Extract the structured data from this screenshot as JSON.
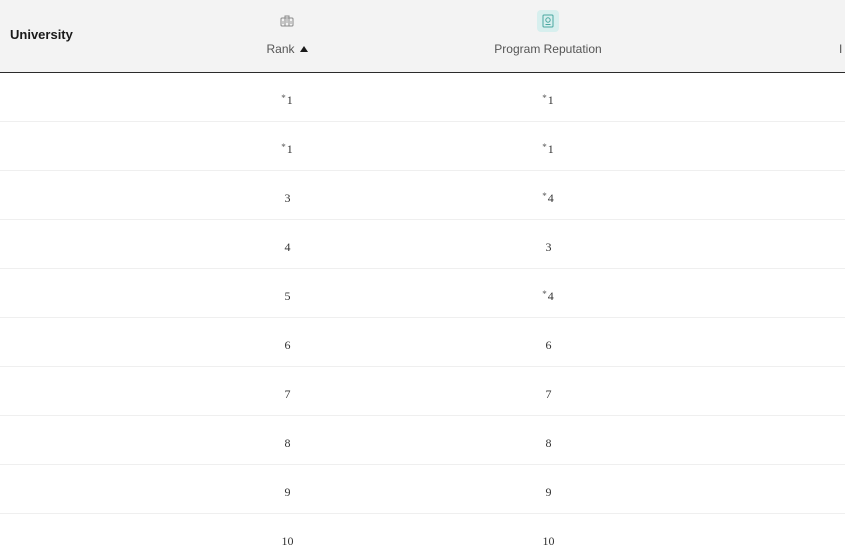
{
  "header": {
    "university_label": "University",
    "columns": [
      {
        "label": "Rank",
        "icon": "ranking-icon",
        "sort": "ascending"
      },
      {
        "label": "Program Reputation",
        "icon": "reputation-badge-icon",
        "icon_bg": "#d7efee"
      }
    ],
    "clipped_column_label": "I"
  },
  "rows": [
    {
      "rank": "1",
      "rank_tie": "*",
      "reputation": "1",
      "reputation_tie": "*"
    },
    {
      "rank": "1",
      "rank_tie": "*",
      "reputation": "1",
      "reputation_tie": "*"
    },
    {
      "rank": "3",
      "rank_tie": "",
      "reputation": "4",
      "reputation_tie": "*"
    },
    {
      "rank": "4",
      "rank_tie": "",
      "reputation": "3",
      "reputation_tie": ""
    },
    {
      "rank": "5",
      "rank_tie": "",
      "reputation": "4",
      "reputation_tie": "*"
    },
    {
      "rank": "6",
      "rank_tie": "",
      "reputation": "6",
      "reputation_tie": ""
    },
    {
      "rank": "7",
      "rank_tie": "",
      "reputation": "7",
      "reputation_tie": ""
    },
    {
      "rank": "8",
      "rank_tie": "",
      "reputation": "8",
      "reputation_tie": ""
    },
    {
      "rank": "9",
      "rank_tie": "",
      "reputation": "9",
      "reputation_tie": ""
    },
    {
      "rank": "10",
      "rank_tie": "",
      "reputation": "10",
      "reputation_tie": ""
    }
  ],
  "colors": {
    "header_bg": "#f3f3f3",
    "header_border": "#2b2b2b",
    "row_divider": "#efefef",
    "accent": "#d7efee"
  }
}
